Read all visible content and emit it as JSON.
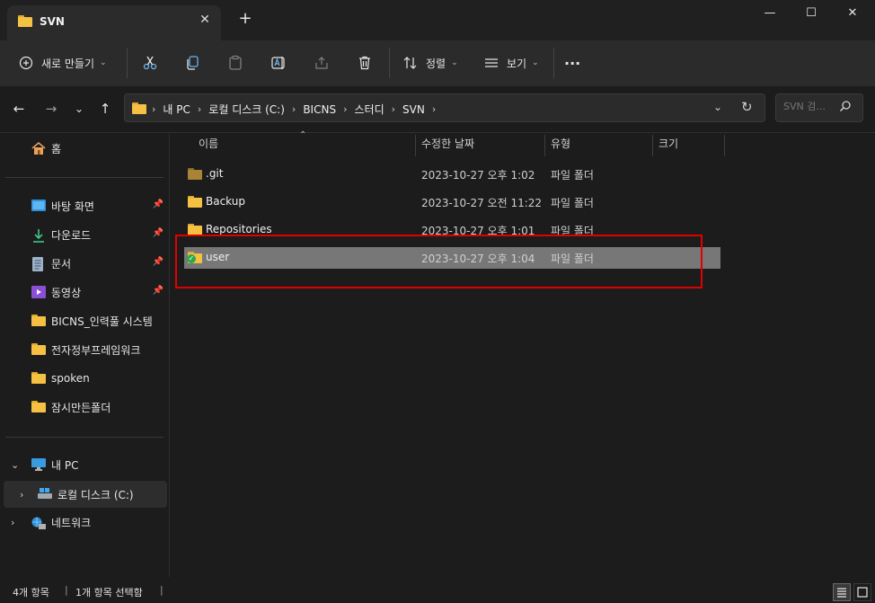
{
  "window": {
    "tab_title": "SVN",
    "new_tab": "+",
    "minimize": "—",
    "maximize": "☐",
    "close": "✕",
    "tab_close": "✕"
  },
  "toolbar": {
    "new_label": "새로 만들기",
    "sort_label": "정렬",
    "view_label": "보기",
    "more": "···"
  },
  "address": {
    "breadcrumbs": [
      "내 PC",
      "로컬 디스크 (C:)",
      "BICNS",
      "스터디",
      "SVN"
    ],
    "search_placeholder": "SVN 검..."
  },
  "sidebar": {
    "home": "홈",
    "quick_access": [
      "바탕 화면",
      "다운로드",
      "문서",
      "동영상",
      "BICNS_인력풀 시스템",
      "전자정부프레임워크",
      "spoken",
      "잠시만든폴더"
    ],
    "this_pc": "내 PC",
    "local_disk": "로컬 디스크 (C:)",
    "network": "네트워크"
  },
  "columns": {
    "name": "이름",
    "modified": "수정한 날짜",
    "type": "유형",
    "size": "크기"
  },
  "files": [
    {
      "name": ".git",
      "modified": "2023-10-27 오후 1:02",
      "type": "파일 폴더"
    },
    {
      "name": "Backup",
      "modified": "2023-10-27 오전 11:22",
      "type": "파일 폴더"
    },
    {
      "name": "Repositories",
      "modified": "2023-10-27 오후 1:01",
      "type": "파일 폴더"
    },
    {
      "name": "user",
      "modified": "2023-10-27 오후 1:04",
      "type": "파일 폴더"
    }
  ],
  "status": {
    "item_count": "4개 항목",
    "selected": "1개 항목 선택함"
  },
  "colors": {
    "highlight_box": "#e00000",
    "selected_row": "#777777"
  }
}
